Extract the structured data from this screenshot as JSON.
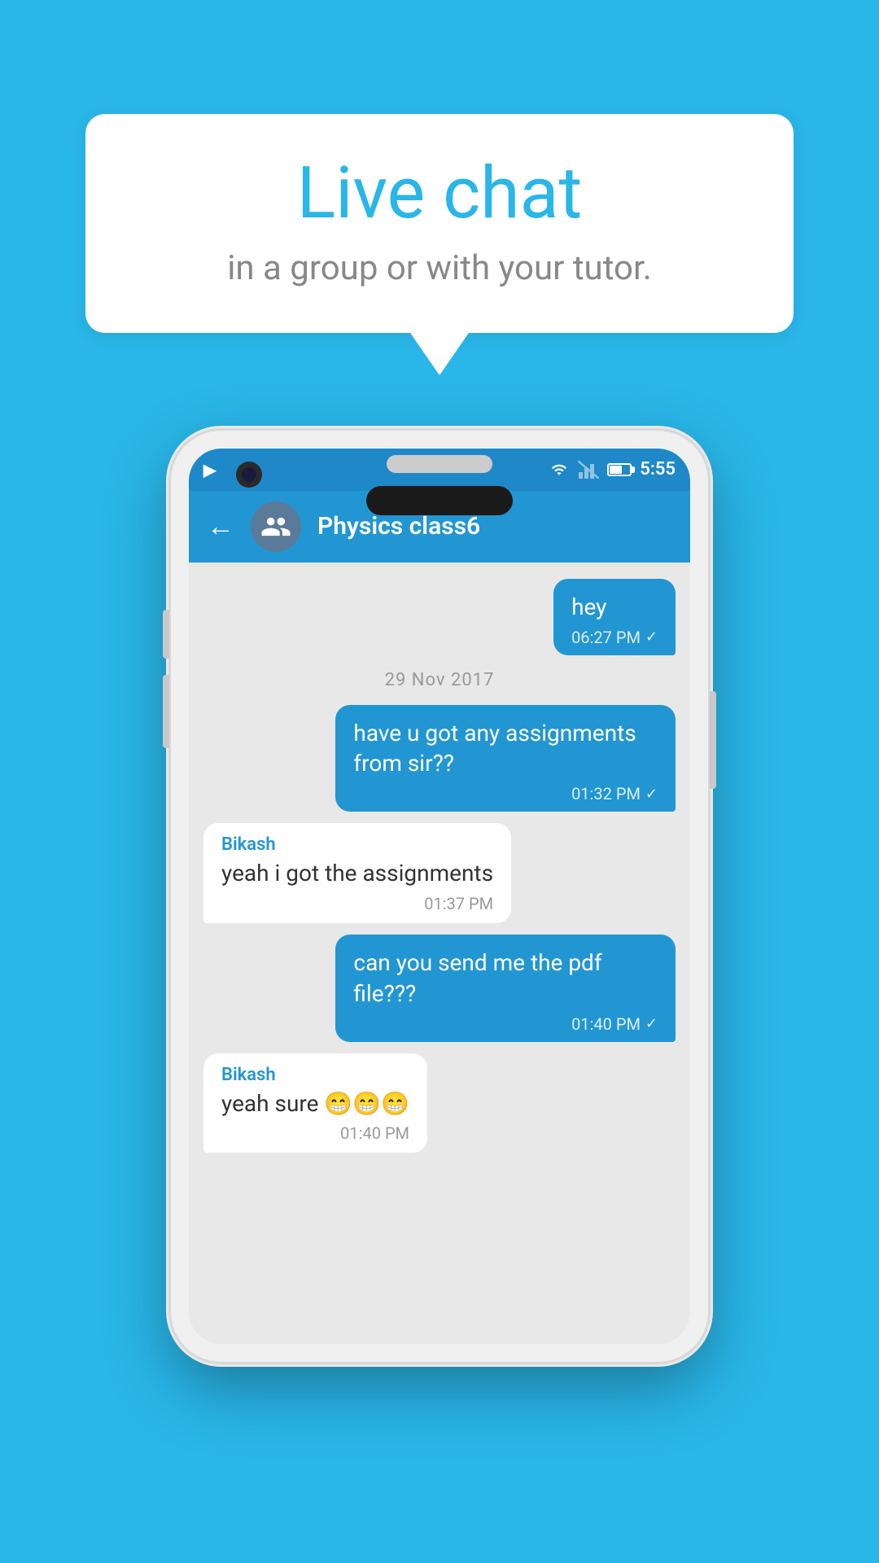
{
  "page": {
    "background_color": "#29b6e8"
  },
  "speech_bubble": {
    "title": "Live chat",
    "subtitle": "in a group or with your tutor."
  },
  "phone": {
    "status_bar": {
      "time": "5:55",
      "notification_icon": "N"
    },
    "toolbar": {
      "chat_name": "Physics class6",
      "back_label": "←"
    },
    "messages": [
      {
        "id": "msg1",
        "type": "sent",
        "text": "hey",
        "time": "06:27 PM",
        "checked": true
      },
      {
        "id": "divider1",
        "type": "divider",
        "text": "29  Nov  2017"
      },
      {
        "id": "msg2",
        "type": "sent",
        "text": "have u got any assignments from sir??",
        "time": "01:32 PM",
        "checked": true
      },
      {
        "id": "msg3",
        "type": "received",
        "sender": "Bikash",
        "text": "yeah i got the assignments",
        "time": "01:37 PM"
      },
      {
        "id": "msg4",
        "type": "sent",
        "text": "can you send me the pdf file???",
        "time": "01:40 PM",
        "checked": true
      },
      {
        "id": "msg5",
        "type": "received",
        "sender": "Bikash",
        "text": "yeah sure 😁😁😁",
        "time": "01:40 PM"
      }
    ]
  }
}
